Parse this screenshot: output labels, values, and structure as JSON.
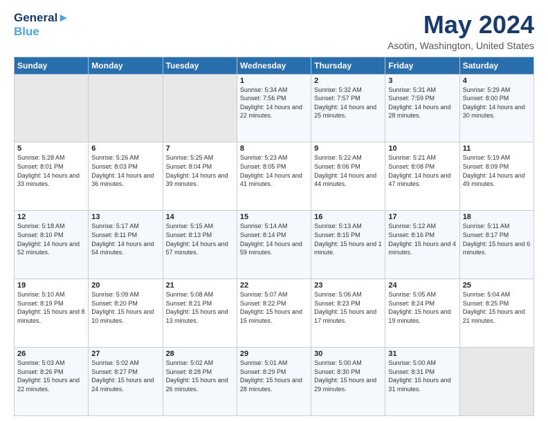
{
  "header": {
    "logo_line1": "General",
    "logo_line2": "Blue",
    "title": "May 2024",
    "subtitle": "Asotin, Washington, United States"
  },
  "weekdays": [
    "Sunday",
    "Monday",
    "Tuesday",
    "Wednesday",
    "Thursday",
    "Friday",
    "Saturday"
  ],
  "weeks": [
    [
      {
        "day": "",
        "empty": true
      },
      {
        "day": "",
        "empty": true
      },
      {
        "day": "",
        "empty": true
      },
      {
        "day": "1",
        "sunrise": "5:34 AM",
        "sunset": "7:56 PM",
        "daylight": "14 hours and 22 minutes."
      },
      {
        "day": "2",
        "sunrise": "5:32 AM",
        "sunset": "7:57 PM",
        "daylight": "14 hours and 25 minutes."
      },
      {
        "day": "3",
        "sunrise": "5:31 AM",
        "sunset": "7:59 PM",
        "daylight": "14 hours and 28 minutes."
      },
      {
        "day": "4",
        "sunrise": "5:29 AM",
        "sunset": "8:00 PM",
        "daylight": "14 hours and 30 minutes."
      }
    ],
    [
      {
        "day": "5",
        "sunrise": "5:28 AM",
        "sunset": "8:01 PM",
        "daylight": "14 hours and 33 minutes."
      },
      {
        "day": "6",
        "sunrise": "5:26 AM",
        "sunset": "8:03 PM",
        "daylight": "14 hours and 36 minutes."
      },
      {
        "day": "7",
        "sunrise": "5:25 AM",
        "sunset": "8:04 PM",
        "daylight": "14 hours and 39 minutes."
      },
      {
        "day": "8",
        "sunrise": "5:23 AM",
        "sunset": "8:05 PM",
        "daylight": "14 hours and 41 minutes."
      },
      {
        "day": "9",
        "sunrise": "5:22 AM",
        "sunset": "8:06 PM",
        "daylight": "14 hours and 44 minutes."
      },
      {
        "day": "10",
        "sunrise": "5:21 AM",
        "sunset": "8:08 PM",
        "daylight": "14 hours and 47 minutes."
      },
      {
        "day": "11",
        "sunrise": "5:19 AM",
        "sunset": "8:09 PM",
        "daylight": "14 hours and 49 minutes."
      }
    ],
    [
      {
        "day": "12",
        "sunrise": "5:18 AM",
        "sunset": "8:10 PM",
        "daylight": "14 hours and 52 minutes."
      },
      {
        "day": "13",
        "sunrise": "5:17 AM",
        "sunset": "8:11 PM",
        "daylight": "14 hours and 54 minutes."
      },
      {
        "day": "14",
        "sunrise": "5:15 AM",
        "sunset": "8:13 PM",
        "daylight": "14 hours and 57 minutes."
      },
      {
        "day": "15",
        "sunrise": "5:14 AM",
        "sunset": "8:14 PM",
        "daylight": "14 hours and 59 minutes."
      },
      {
        "day": "16",
        "sunrise": "5:13 AM",
        "sunset": "8:15 PM",
        "daylight": "15 hours and 1 minute."
      },
      {
        "day": "17",
        "sunrise": "5:12 AM",
        "sunset": "8:16 PM",
        "daylight": "15 hours and 4 minutes."
      },
      {
        "day": "18",
        "sunrise": "5:11 AM",
        "sunset": "8:17 PM",
        "daylight": "15 hours and 6 minutes."
      }
    ],
    [
      {
        "day": "19",
        "sunrise": "5:10 AM",
        "sunset": "8:19 PM",
        "daylight": "15 hours and 8 minutes."
      },
      {
        "day": "20",
        "sunrise": "5:09 AM",
        "sunset": "8:20 PM",
        "daylight": "15 hours and 10 minutes."
      },
      {
        "day": "21",
        "sunrise": "5:08 AM",
        "sunset": "8:21 PM",
        "daylight": "15 hours and 13 minutes."
      },
      {
        "day": "22",
        "sunrise": "5:07 AM",
        "sunset": "8:22 PM",
        "daylight": "15 hours and 15 minutes."
      },
      {
        "day": "23",
        "sunrise": "5:06 AM",
        "sunset": "8:23 PM",
        "daylight": "15 hours and 17 minutes."
      },
      {
        "day": "24",
        "sunrise": "5:05 AM",
        "sunset": "8:24 PM",
        "daylight": "15 hours and 19 minutes."
      },
      {
        "day": "25",
        "sunrise": "5:04 AM",
        "sunset": "8:25 PM",
        "daylight": "15 hours and 21 minutes."
      }
    ],
    [
      {
        "day": "26",
        "sunrise": "5:03 AM",
        "sunset": "8:26 PM",
        "daylight": "15 hours and 22 minutes."
      },
      {
        "day": "27",
        "sunrise": "5:02 AM",
        "sunset": "8:27 PM",
        "daylight": "15 hours and 24 minutes."
      },
      {
        "day": "28",
        "sunrise": "5:02 AM",
        "sunset": "8:28 PM",
        "daylight": "15 hours and 26 minutes."
      },
      {
        "day": "29",
        "sunrise": "5:01 AM",
        "sunset": "8:29 PM",
        "daylight": "15 hours and 28 minutes."
      },
      {
        "day": "30",
        "sunrise": "5:00 AM",
        "sunset": "8:30 PM",
        "daylight": "15 hours and 29 minutes."
      },
      {
        "day": "31",
        "sunrise": "5:00 AM",
        "sunset": "8:31 PM",
        "daylight": "15 hours and 31 minutes."
      },
      {
        "day": "",
        "empty": true
      }
    ]
  ]
}
